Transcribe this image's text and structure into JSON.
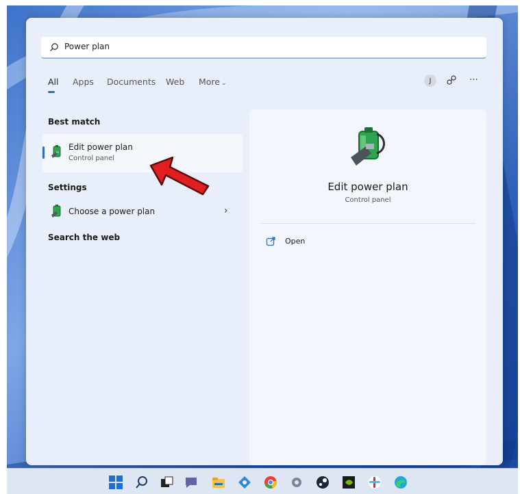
{
  "search": {
    "value": "Power plan"
  },
  "tabs": [
    {
      "label": "All"
    },
    {
      "label": "Apps"
    },
    {
      "label": "Documents"
    },
    {
      "label": "Web"
    },
    {
      "label": "More"
    }
  ],
  "account": {
    "initial": "J"
  },
  "icons": {
    "search": "search-icon",
    "share": "share-icon",
    "more": "more-icon",
    "battery": "battery-plug-icon",
    "open": "open-external-icon"
  },
  "best_match": {
    "heading": "Best match",
    "title": "Edit power plan",
    "subtitle": "Control panel"
  },
  "settings": {
    "heading": "Settings",
    "item_label": "Choose a power plan"
  },
  "web": {
    "heading": "Search the web"
  },
  "preview": {
    "title": "Edit power plan",
    "subtitle": "Control panel",
    "action_label": "Open"
  },
  "colors": {
    "accent": "#2b6cc4",
    "arrow": "#e02020",
    "panel": "#e8eefa"
  }
}
